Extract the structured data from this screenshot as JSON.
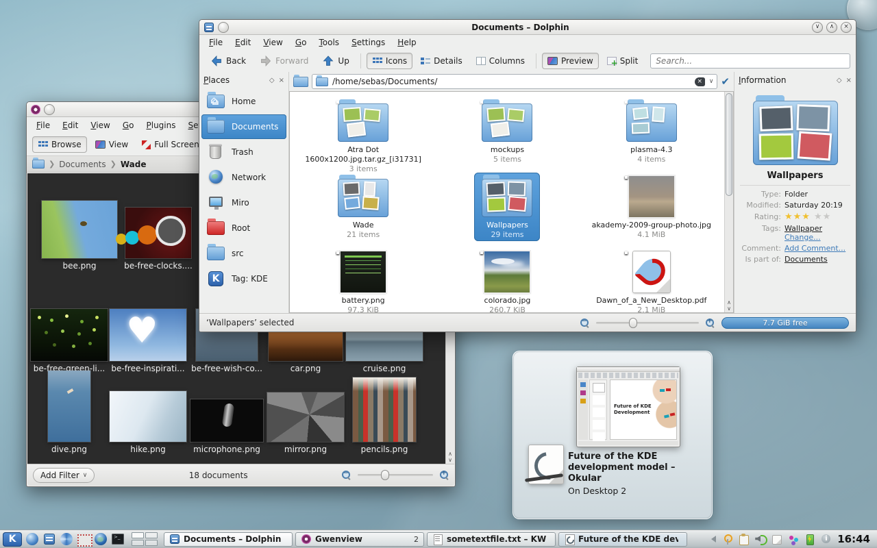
{
  "colors": {
    "sel-blue": "#5ea2dd",
    "sel-blue-dark": "#3c85c6",
    "folder-blue": "#6ba3d6",
    "win-bg": "#eeefee",
    "view-bg": "#ffffff",
    "dark-bg": "#2b2b2b"
  },
  "dolphin": {
    "title": "Documents – Dolphin",
    "menu": [
      "File",
      "Edit",
      "View",
      "Go",
      "Tools",
      "Settings",
      "Help"
    ],
    "toolbar": {
      "back": "Back",
      "forward": "Forward",
      "up": "Up",
      "icons": "Icons",
      "details": "Details",
      "columns": "Columns",
      "preview": "Preview",
      "split": "Split",
      "search_placeholder": "Search..."
    },
    "location": {
      "path": "/home/sebas/Documents/"
    },
    "places": {
      "title": "Places",
      "float_icon": "◇",
      "close_icon": "×",
      "items": [
        {
          "label": "Home",
          "icon": "pi-home",
          "state": ""
        },
        {
          "label": "Documents",
          "icon": "pi-docs",
          "state": "selected"
        },
        {
          "label": "Trash",
          "icon": "pi-trash-i",
          "state": ""
        },
        {
          "label": "Network",
          "icon": "pi-globe-i",
          "state": ""
        },
        {
          "label": "Miro",
          "icon": "pi-miro",
          "state": ""
        },
        {
          "label": "Root",
          "icon": "pi-root",
          "state": ""
        },
        {
          "label": "src",
          "icon": "pi-src",
          "state": ""
        },
        {
          "label": "Tag: KDE",
          "icon": "pi-kde-i",
          "state": ""
        }
      ]
    },
    "files": [
      {
        "name": "Atra Dot 1600x1200.jpg.tar.gz_[i31731]",
        "meta": "3 items",
        "kind": "k-folder-green",
        "state": ""
      },
      {
        "name": "mockups",
        "meta": "5 items",
        "kind": "k-folder-green",
        "state": ""
      },
      {
        "name": "plasma-4.3",
        "meta": "4 items",
        "kind": "k-folder-teal",
        "state": ""
      },
      {
        "name": "Wade",
        "meta": "21 items",
        "kind": "k-folder-photos",
        "state": ""
      },
      {
        "name": "Wallpapers",
        "meta": "29 items",
        "kind": "k-folder-wallpapers",
        "state": "selected"
      },
      {
        "name": "akademy-2009-group-photo.jpg",
        "meta": "4.1 MiB",
        "kind": "k-thumb-akademy",
        "state": ""
      },
      {
        "name": "battery.png",
        "meta": "97.3 KiB",
        "kind": "k-thumb-battery",
        "state": ""
      },
      {
        "name": "colorado.jpg",
        "meta": "260.7 KiB",
        "kind": "k-thumb-colorado",
        "state": ""
      },
      {
        "name": "Dawn_of_a_New_Desktop.pdf",
        "meta": "2.1 MiB",
        "kind": "k-pdf",
        "state": ""
      }
    ],
    "info": {
      "title": "Information",
      "float_icon": "◇",
      "close_icon": "×",
      "name": "Wallpapers",
      "type_label": "Type:",
      "type_value": "Folder",
      "modified_label": "Modified:",
      "modified_value": "Saturday 20:19",
      "rating_label": "Rating:",
      "stars_on": "★★★",
      "stars_off": "★★",
      "tags_label": "Tags:",
      "tags_value": "Wallpaper",
      "tags_change": "Change...",
      "comment_label": "Comment:",
      "comment_value": "Add Comment...",
      "partof_label": "Is part of:",
      "partof_value": "Documents"
    },
    "statusbar": {
      "selection": "‘Wallpapers’ selected",
      "free": "7.7 GiB free"
    }
  },
  "gwenview": {
    "menu": [
      "File",
      "Edit",
      "View",
      "Go",
      "Plugins",
      "Settings"
    ],
    "toolbar": {
      "browse": "Browse",
      "view": "View",
      "fullscreen": "Full Screen"
    },
    "breadcrumb": {
      "parent": "Documents",
      "current": "Wade"
    },
    "row1": [
      {
        "name": "bee.png",
        "thumb": "th-bee",
        "pos": "g-r1 g-c1",
        "state": "selected"
      },
      {
        "name": "be-free-clocks....",
        "thumb": "th-clocks",
        "pos": "g-r1 g-c2",
        "state": ""
      },
      {
        "name": "be-free-wish-co...",
        "thumb": "th-wish",
        "pos": "g-r1 g-c3",
        "state": ""
      }
    ],
    "row2": [
      {
        "name": "be-free-green-li...",
        "thumb": "th-green-lights",
        "pos": "g-r2 g-c1",
        "state": ""
      },
      {
        "name": "be-free-inspirati...",
        "thumb": "th-heart",
        "pos": "g-r2 g-c2",
        "state": ""
      },
      {
        "name": "be-free-wish-co...",
        "thumb": "th-wish",
        "pos": "g-r2 g-c3",
        "state": ""
      },
      {
        "name": "car.png",
        "thumb": "th-car",
        "pos": "g-r2 g-c4",
        "state": ""
      },
      {
        "name": "cruise.png",
        "thumb": "th-cruise",
        "pos": "g-r2 g-c5",
        "state": ""
      }
    ],
    "row3": [
      {
        "name": "dive.png",
        "thumb": "th-dive",
        "pos": "g-r3 g-c1",
        "state": ""
      },
      {
        "name": "hike.png",
        "thumb": "th-hike",
        "pos": "g-r3 g-c2",
        "state": ""
      },
      {
        "name": "microphone.png",
        "thumb": "th-mic",
        "pos": "g-r3 g-c3",
        "state": ""
      },
      {
        "name": "mirror.png",
        "thumb": "th-mirror",
        "pos": "g-r3 g-c4",
        "state": ""
      },
      {
        "name": "pencils.png",
        "thumb": "th-pencils",
        "pos": "g-r3 g-c5",
        "state": ""
      }
    ],
    "statusbar": {
      "filter": "Add Filter",
      "count": "18 documents"
    }
  },
  "tooltip": {
    "title": "Future of the KDE development model – Okular",
    "desktop": "On Desktop 2",
    "slide": "Future of KDE Development"
  },
  "taskbar": {
    "launchers": [
      "system-sphere",
      "dolphin-launcher",
      "plasma-swirl",
      "clip-screen",
      "globe-browser",
      "terminal"
    ],
    "kmenu_label": "K",
    "tasks": [
      {
        "label": "Documents – Dolphin",
        "icon": "dolphin",
        "state": "active",
        "badge": ""
      },
      {
        "label": "Gwenview",
        "icon": "gwenview",
        "state": "",
        "badge": "2"
      },
      {
        "label": "sometextfile.txt – KWrite",
        "icon": "kwrite",
        "state": "",
        "badge": ""
      },
      {
        "label": "Future of the KDE developme",
        "icon": "okular",
        "state": "hover",
        "badge": ""
      }
    ],
    "tray": [
      "tray-expander",
      "tray-antenna",
      "tray-clipboard",
      "tray-volume",
      "tray-notes",
      "tray-devices",
      "tray-battery",
      "tray-info"
    ],
    "clock": "16:44"
  }
}
